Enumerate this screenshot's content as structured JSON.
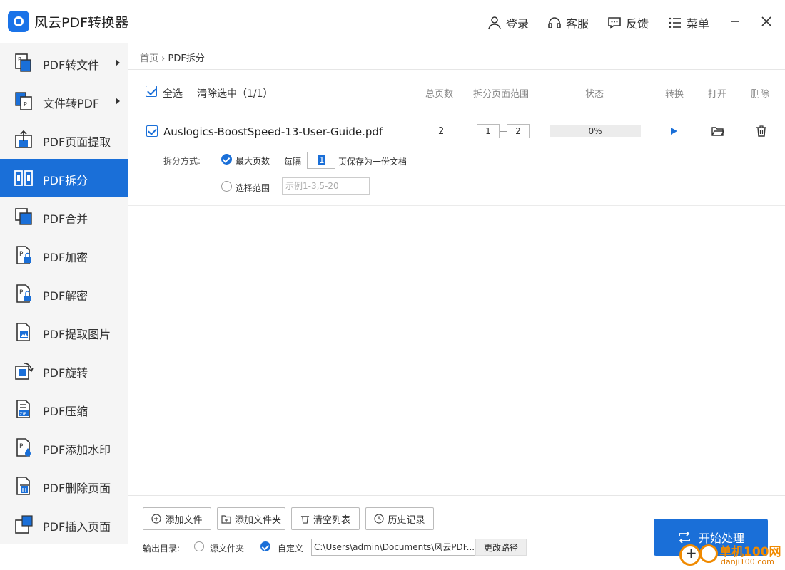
{
  "app": {
    "title": "风云PDF转换器"
  },
  "toolbar": {
    "login": "登录",
    "service": "客服",
    "feedback": "反馈",
    "menu": "菜单"
  },
  "sidebar": {
    "items": [
      {
        "label": "PDF转文件",
        "icon": "pdf-to-file-icon",
        "submenu": true
      },
      {
        "label": "文件转PDF",
        "icon": "file-to-pdf-icon",
        "submenu": true
      },
      {
        "label": "PDF页面提取",
        "icon": "page-extract-icon"
      },
      {
        "label": "PDF拆分",
        "icon": "split-icon",
        "active": true
      },
      {
        "label": "PDF合并",
        "icon": "merge-icon"
      },
      {
        "label": "PDF加密",
        "icon": "lock-icon"
      },
      {
        "label": "PDF解密",
        "icon": "unlock-icon"
      },
      {
        "label": "PDF提取图片",
        "icon": "image-extract-icon"
      },
      {
        "label": "PDF旋转",
        "icon": "rotate-icon"
      },
      {
        "label": "PDF压缩",
        "icon": "zip-icon"
      },
      {
        "label": "PDF添加水印",
        "icon": "watermark-icon"
      },
      {
        "label": "PDF删除页面",
        "icon": "delete-page-icon"
      },
      {
        "label": "PDF插入页面",
        "icon": "insert-page-icon"
      }
    ]
  },
  "breadcrumb": {
    "home": "首页",
    "separator": "›",
    "current": "PDF拆分"
  },
  "list_header": {
    "select_all": "全选",
    "clear_selected": "清除选中（1/1）",
    "columns": {
      "total_pages": "总页数",
      "range": "拆分页面范围",
      "status": "状态",
      "convert": "转换",
      "open": "打开",
      "delete": "删除"
    }
  },
  "file_row": {
    "name": "Auslogics-BoostSpeed-13-User-Guide.pdf",
    "total_pages": "2",
    "range_from": "1",
    "range_to": "2",
    "progress_label": "0%",
    "progress_fraction": 0
  },
  "split_options": {
    "label": "拆分方式:",
    "max_pages": "最大页数",
    "every": "每隔",
    "every_value": "1",
    "save_suffix": "页保存为一份文档",
    "select_range": "选择范围",
    "range_placeholder": "示例1-3,5-20"
  },
  "bottom": {
    "add_file": "添加文件",
    "add_folder": "添加文件夹",
    "clear_list": "清空列表",
    "history": "历史记录",
    "output_label": "输出目录:",
    "source_folder": "源文件夹",
    "custom": "自定义",
    "path": "C:\\Users\\admin\\Documents\\风云PDF...",
    "change_path": "更改路径",
    "start": "开始处理"
  },
  "watermark": {
    "brand": "单机100网",
    "domain": "danji100.com"
  },
  "colors": {
    "accent": "#1a6fd8",
    "sidebar_bg": "#f5f5f5",
    "watermark": "#f08a00"
  }
}
